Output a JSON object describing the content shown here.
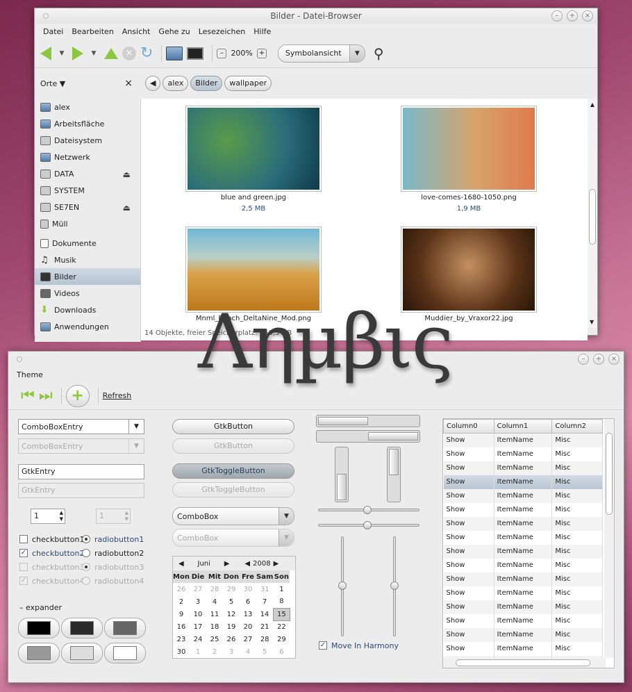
{
  "browser": {
    "title": "Bilder - Datei-Browser",
    "menu": [
      "Datei",
      "Bearbeiten",
      "Ansicht",
      "Gehe zu",
      "Lesezeichen",
      "Hilfe"
    ],
    "zoom": "200%",
    "view_mode": "Symbolansicht",
    "places_label": "Orte",
    "places": [
      "alex",
      "Arbeitsfläche",
      "Dateisystem",
      "Netzwerk",
      "DATA",
      "SYSTEM",
      "SE7EN",
      "Müll",
      "Dokumente",
      "Musik",
      "Bilder",
      "Videos",
      "Downloads",
      "Anwendungen"
    ],
    "path": [
      "alex",
      "Bilder",
      "wallpaper"
    ],
    "files": [
      {
        "name": "blue and green.jpg",
        "size": "2,5 MB"
      },
      {
        "name": "love-comes-1680-1050.png",
        "size": "1,9 MB"
      },
      {
        "name": "Mnml_Beach_DeltaNine_Mod.png",
        "size": ""
      },
      {
        "name": "Muddier_by_Vraxor22.jpg",
        "size": ""
      }
    ],
    "status": "14 Objekte, freier Speicherplatz: 156,3 GB"
  },
  "watermark": "Anubis",
  "theme": {
    "menu": "Theme",
    "refresh": "Refresh",
    "combo_entry": "ComboBoxEntry",
    "gtk_entry": "GtkEntry",
    "spin_value": "1",
    "checks": [
      "checkbutton1",
      "checkbutton2",
      "checkbutton3",
      "checkbutton4"
    ],
    "radios": [
      "radiobutton1",
      "radiobutton2",
      "radiobutton3",
      "radiobutton4"
    ],
    "expander": "expander",
    "gtk_button": "GtkButton",
    "toggle_button": "GtkToggleButton",
    "combo": "ComboBox",
    "cal_month": "Juni",
    "cal_year": "2008",
    "cal_days": [
      "Mon",
      "Die",
      "Mit",
      "Don",
      "Fre",
      "Sam",
      "Son"
    ],
    "move_harmony": "Move In Harmony",
    "columns": [
      "Column0",
      "Column1",
      "Column2"
    ],
    "row": [
      "Show",
      "ItemName",
      "Misc"
    ]
  }
}
